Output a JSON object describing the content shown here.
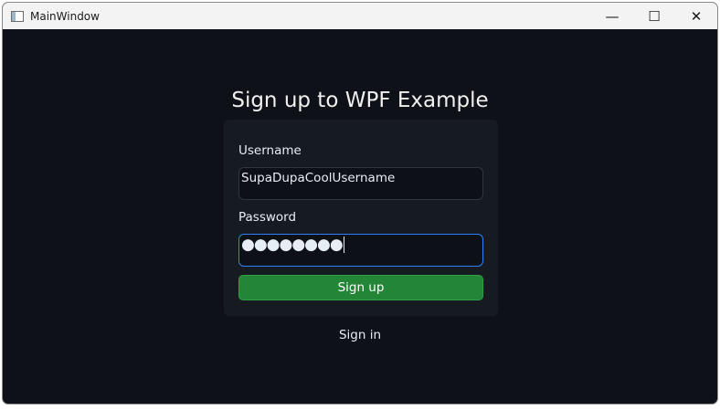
{
  "window": {
    "title": "MainWindow",
    "minimize_glyph": "—",
    "maximize_glyph": "☐",
    "close_glyph": "✕",
    "icon": "window-app-icon"
  },
  "form": {
    "heading": "Sign up to WPF Example",
    "username_label": "Username",
    "username_value": "SupaDupaCoolUsername",
    "password_label": "Password",
    "password_masked": "●●●●●●●●",
    "submit_label": "Sign up",
    "signin_link": "Sign in"
  },
  "colors": {
    "background": "#0e1117",
    "card": "#161b22",
    "accent_button": "#238636",
    "focus_border": "#2f81f7"
  }
}
